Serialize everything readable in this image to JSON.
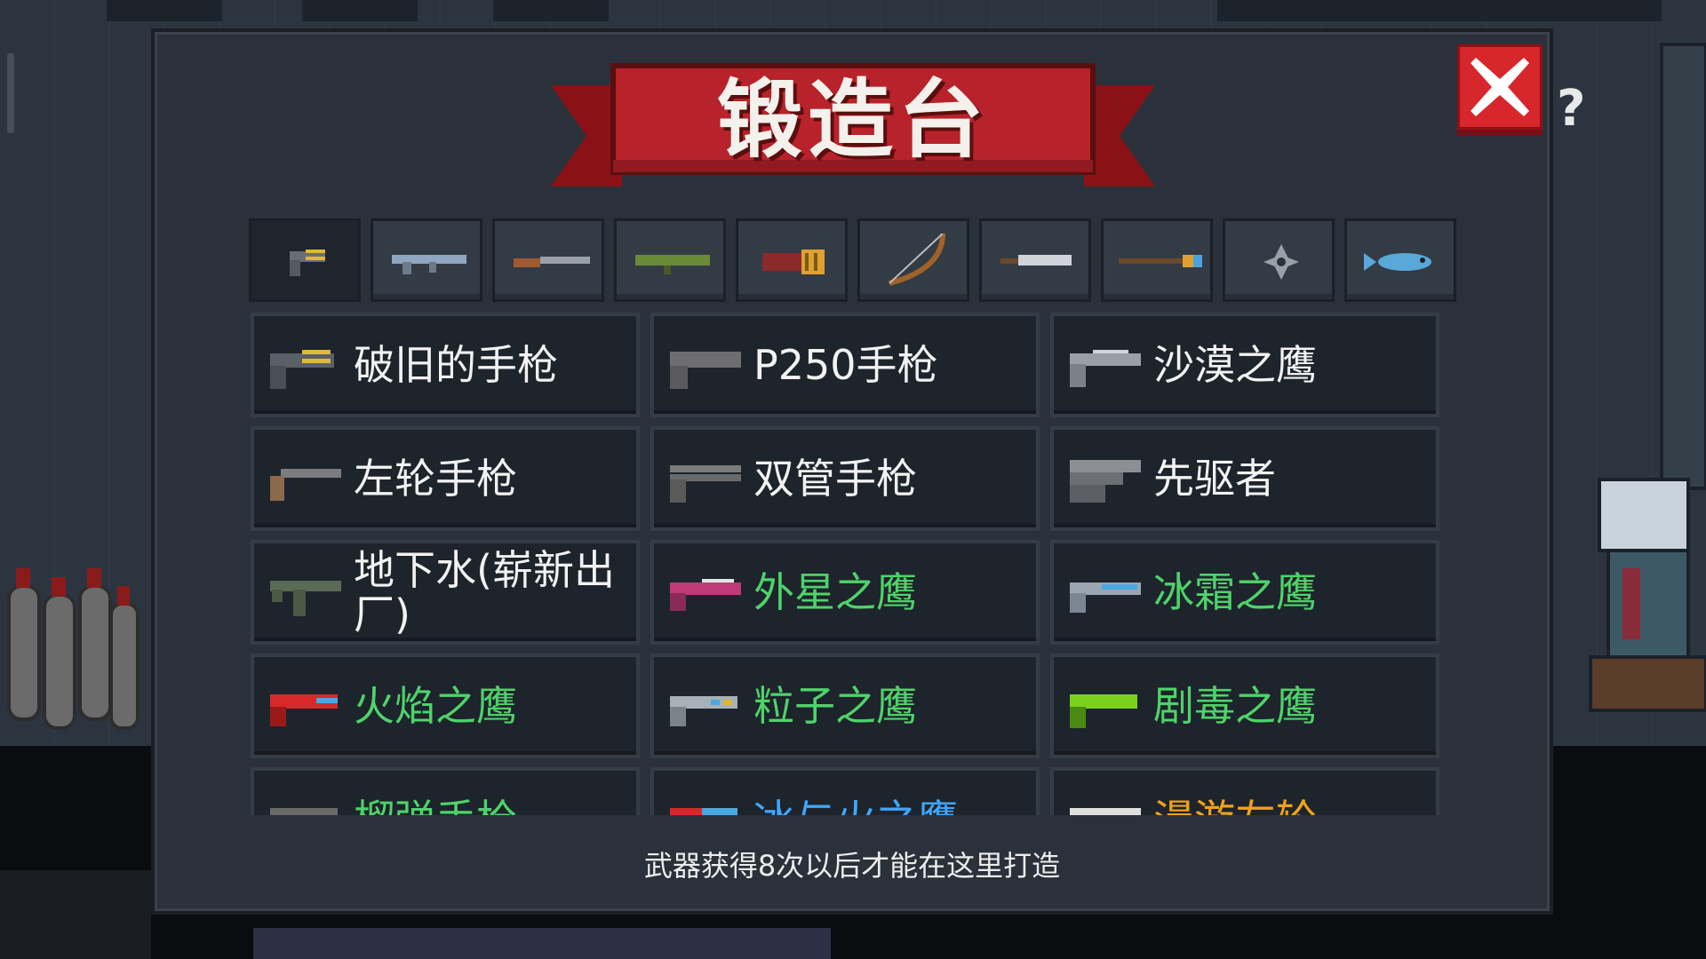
{
  "title": "锻造台",
  "help_mark": "?",
  "colors": {
    "banner_red": "#b8222a",
    "normal": "#f2f2f2",
    "green": "#4ed36a",
    "blue": "#3ea6ff",
    "orange": "#f0a21b"
  },
  "tabs": [
    {
      "icon": "pistol-icon",
      "active": true
    },
    {
      "icon": "rifle-icon"
    },
    {
      "icon": "shotgun-icon"
    },
    {
      "icon": "launcher-icon"
    },
    {
      "icon": "gatling-icon"
    },
    {
      "icon": "bow-icon"
    },
    {
      "icon": "sword-icon"
    },
    {
      "icon": "staff-icon"
    },
    {
      "icon": "shuriken-icon"
    },
    {
      "icon": "fish-icon"
    }
  ],
  "weapons": [
    {
      "name": "破旧的手枪",
      "rarity": "normal",
      "icon_color": "#5b5f66"
    },
    {
      "name": "P250手枪",
      "rarity": "normal",
      "icon_color": "#6e6e70"
    },
    {
      "name": "沙漠之鹰",
      "rarity": "normal",
      "icon_color": "#9a9ea6"
    },
    {
      "name": "左轮手枪",
      "rarity": "normal",
      "icon_color": "#8a6a4a"
    },
    {
      "name": "双管手枪",
      "rarity": "normal",
      "icon_color": "#7a7a7a"
    },
    {
      "name": "先驱者",
      "rarity": "normal",
      "icon_color": "#8c8f94"
    },
    {
      "name": "地下水(崭新出厂)",
      "rarity": "normal",
      "icon_color": "#5a6a55"
    },
    {
      "name": "外星之鹰",
      "rarity": "green",
      "icon_color": "#c03a78"
    },
    {
      "name": "冰霜之鹰",
      "rarity": "green",
      "icon_color": "#4aa8e0"
    },
    {
      "name": "火焰之鹰",
      "rarity": "green",
      "icon_color": "#d8282a"
    },
    {
      "name": "粒子之鹰",
      "rarity": "green",
      "icon_color": "#a8b0b8"
    },
    {
      "name": "剧毒之鹰",
      "rarity": "green",
      "icon_color": "#7ad21c"
    },
    {
      "name": "榴弹手枪",
      "rarity": "green",
      "icon_color": "#6a6a6a"
    },
    {
      "name": "冰与火之鹰",
      "rarity": "blue",
      "icon_color": "#d8282a"
    },
    {
      "name": "漫游左轮",
      "rarity": "orange",
      "icon_color": "#e0e0e0"
    }
  ],
  "footer": "武器获得8次以后才能在这里打造"
}
